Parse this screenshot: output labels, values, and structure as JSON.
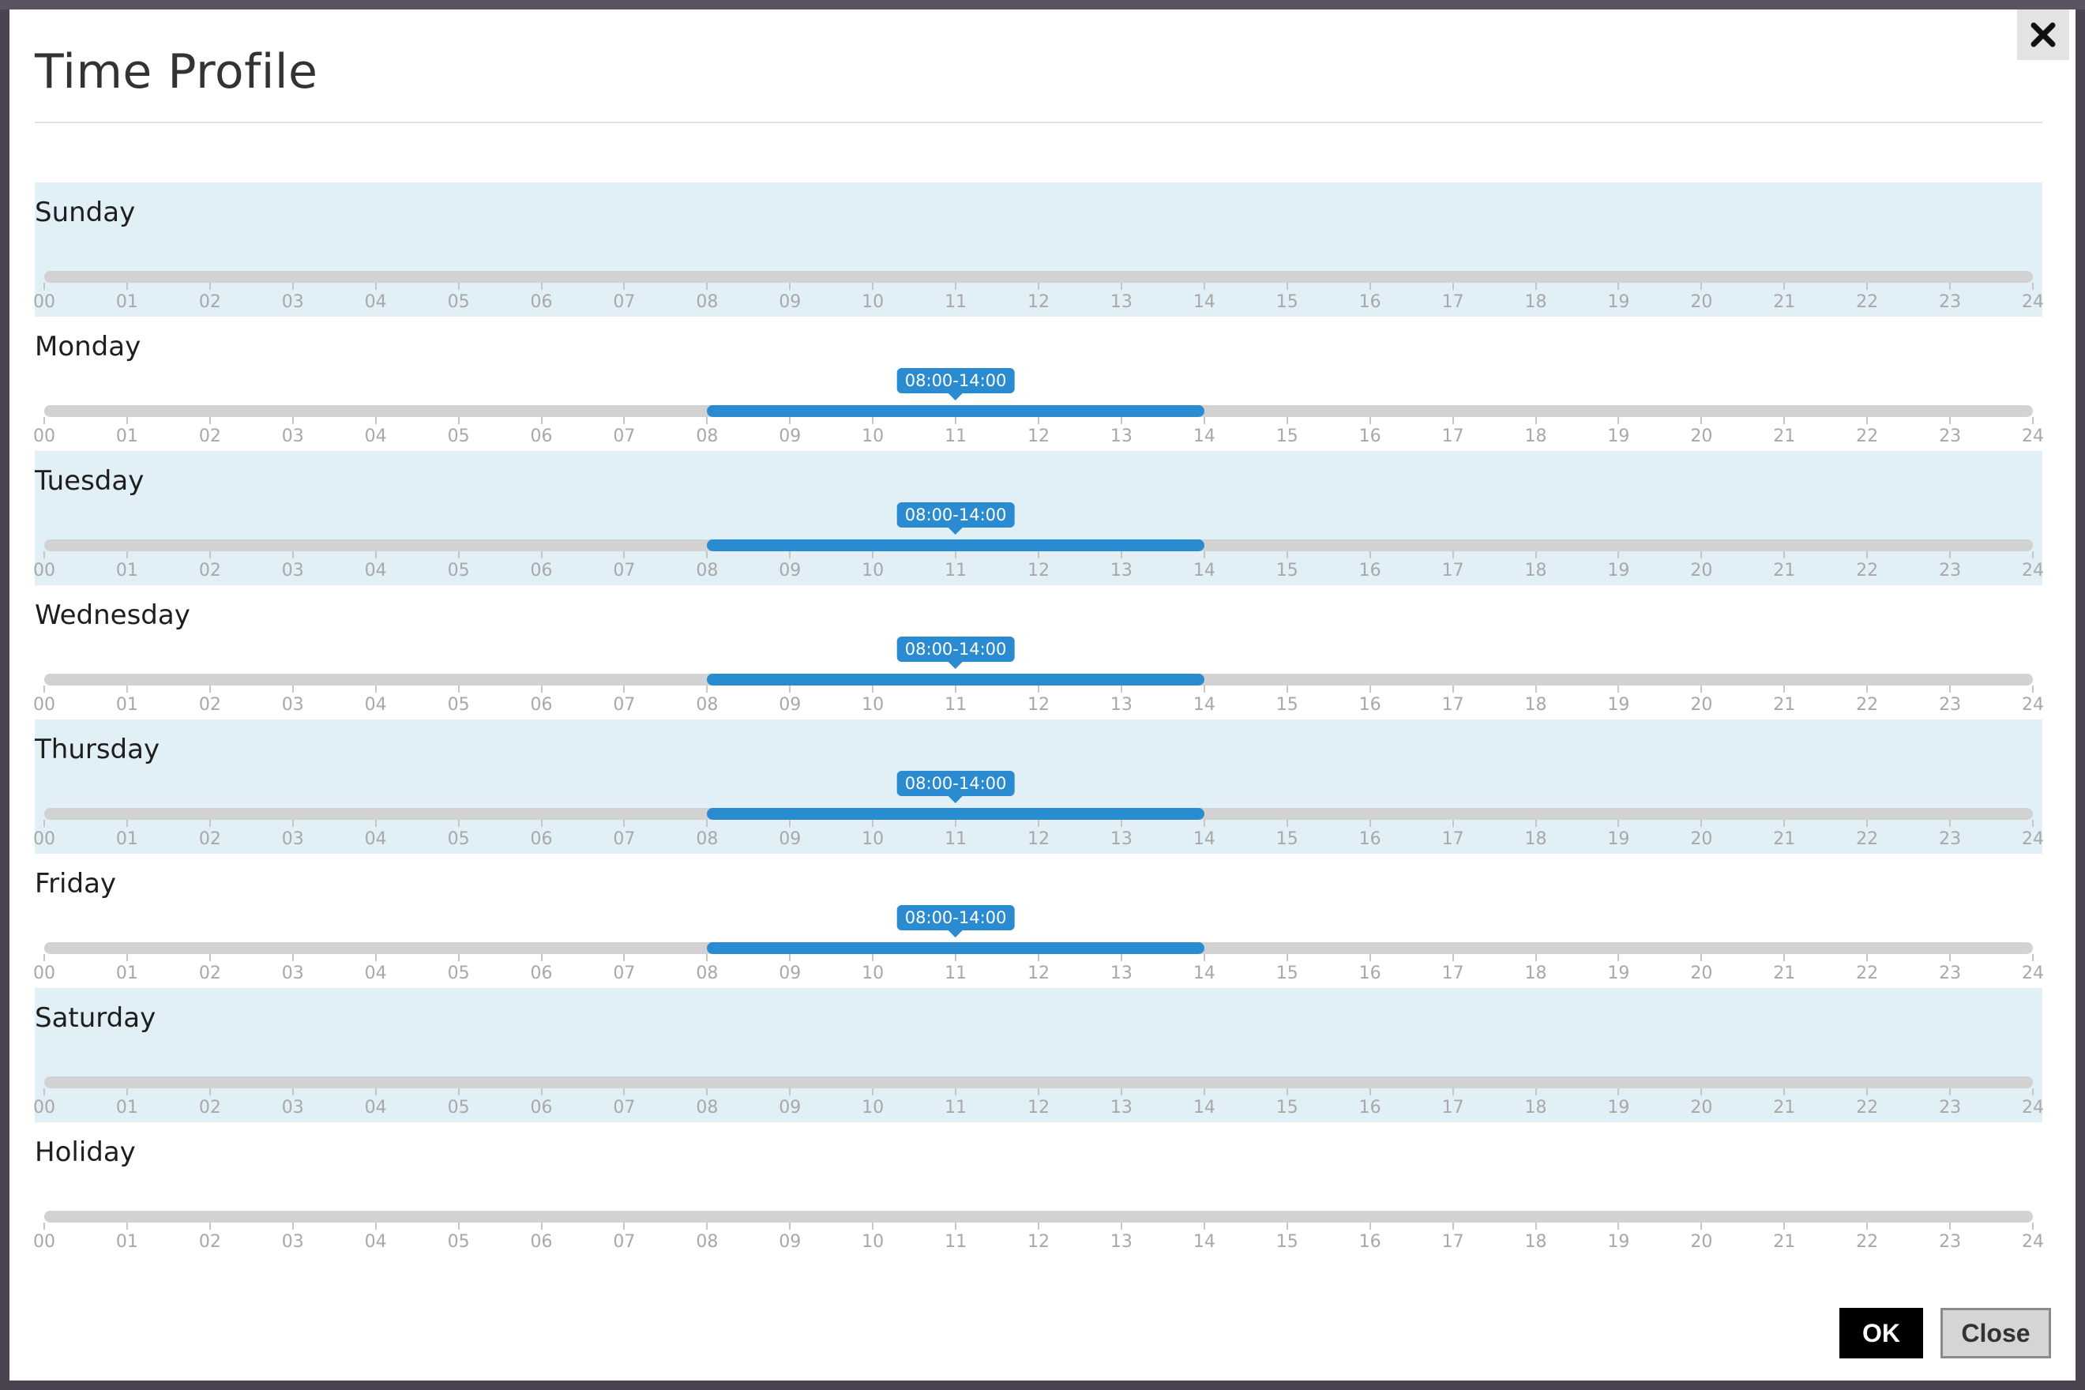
{
  "dialog": {
    "title": "Time Profile",
    "close_icon": "close-x-icon",
    "ok_label": "OK",
    "close_label": "Close"
  },
  "hour_ticks": [
    "00",
    "01",
    "02",
    "03",
    "04",
    "05",
    "06",
    "07",
    "08",
    "09",
    "10",
    "11",
    "12",
    "13",
    "14",
    "15",
    "16",
    "17",
    "18",
    "19",
    "20",
    "21",
    "22",
    "23",
    "24"
  ],
  "days": [
    {
      "name": "Sunday",
      "shaded": true,
      "range": null
    },
    {
      "name": "Monday",
      "shaded": false,
      "range": {
        "start": 8,
        "end": 14,
        "label": "08:00-14:00"
      }
    },
    {
      "name": "Tuesday",
      "shaded": true,
      "range": {
        "start": 8,
        "end": 14,
        "label": "08:00-14:00"
      }
    },
    {
      "name": "Wednesday",
      "shaded": false,
      "range": {
        "start": 8,
        "end": 14,
        "label": "08:00-14:00"
      }
    },
    {
      "name": "Thursday",
      "shaded": true,
      "range": {
        "start": 8,
        "end": 14,
        "label": "08:00-14:00"
      }
    },
    {
      "name": "Friday",
      "shaded": false,
      "range": {
        "start": 8,
        "end": 14,
        "label": "08:00-14:00"
      }
    },
    {
      "name": "Saturday",
      "shaded": true,
      "range": null
    },
    {
      "name": "Holiday",
      "shaded": false,
      "range": null
    }
  ],
  "colors": {
    "range_fill": "#2b8bd0",
    "row_shade": "#e1eff7",
    "track": "#d2d2d2"
  }
}
